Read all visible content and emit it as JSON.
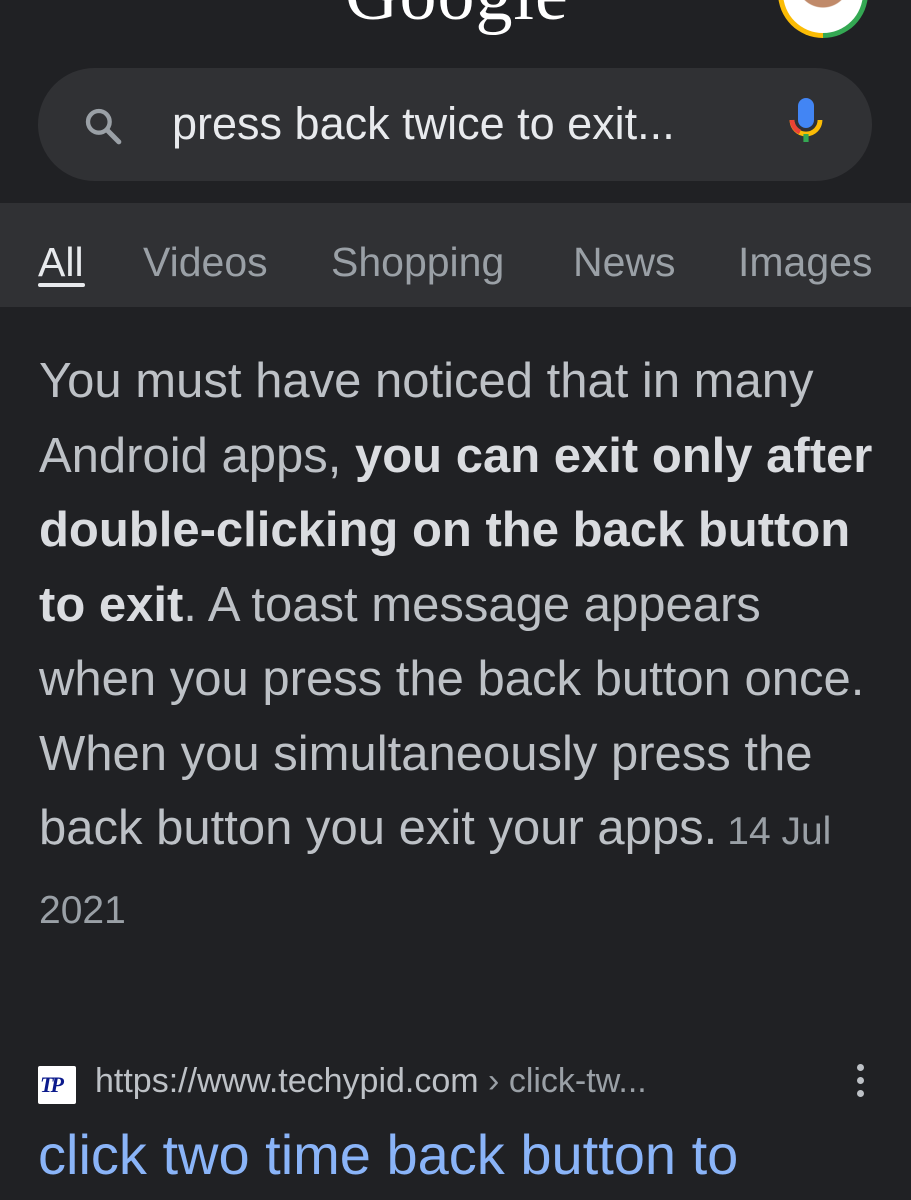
{
  "header": {
    "logo_text": "Google",
    "search": {
      "query": "press back twice to exit..."
    }
  },
  "tabs": [
    {
      "label": "All",
      "active": true
    },
    {
      "label": "Videos",
      "active": false
    },
    {
      "label": "Shopping",
      "active": false
    },
    {
      "label": "News",
      "active": false
    },
    {
      "label": "Images",
      "active": false
    }
  ],
  "snippet": {
    "text_1": "You must have noticed that in many Android apps, ",
    "bold": "you can exit only after double-clicking on the back button to exit",
    "text_2": ". A toast message appears when you press the back button once. When you simultaneously press the back button you exit your apps.",
    "date": "14 Jul 2021"
  },
  "result": {
    "favicon_text": "TP",
    "url": "https://www.techypid.com",
    "breadcrumb": " › click-tw...",
    "title": "click two time back button to"
  },
  "icons": {
    "search": "search-icon",
    "mic": "mic-icon",
    "more": "more-vert-icon",
    "avatar": "account-avatar"
  },
  "colors": {
    "background": "#202124",
    "search_bar": "#303134",
    "link": "#8ab4f8",
    "text": "#bdc1c6"
  }
}
